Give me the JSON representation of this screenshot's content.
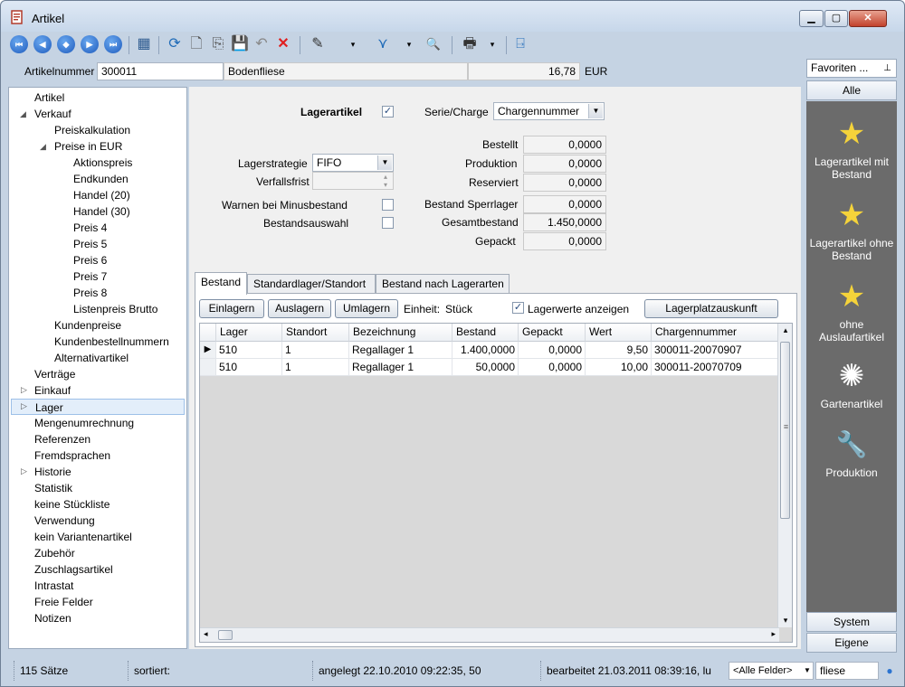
{
  "window": {
    "title": "Artikel",
    "min_glyph": "▁",
    "max_glyph": "▢",
    "close_glyph": "✕"
  },
  "toolbar": {
    "nav_first": "⏮",
    "nav_prev": "◀",
    "nav_both": "◆",
    "nav_next": "▶",
    "nav_last": "⏭",
    "glyphs": {
      "table": "▦",
      "refresh": "⟳",
      "new": "🗋",
      "copy": "⎘",
      "save": "💾",
      "undo": "↶",
      "delete": "✕",
      "tools": "✎",
      "filter": "⋎",
      "search": "🔍",
      "print": "🖶",
      "exit": "⍈",
      "dropdown": "▾"
    }
  },
  "header": {
    "artikelnummer_label": "Artikelnummer",
    "artikelnummer": "300011",
    "bezeichnung": "Bodenfliese",
    "preis": "16,78",
    "waehrung": "EUR"
  },
  "tree": {
    "expanded_glyph": "◢",
    "collapsed_glyph": "▷",
    "items": [
      {
        "label": "Artikel"
      },
      {
        "label": "Verkauf"
      },
      {
        "label": "Preiskalkulation"
      },
      {
        "label": "Preise in EUR"
      },
      {
        "label": "Aktionspreis"
      },
      {
        "label": "Endkunden"
      },
      {
        "label": "Handel (20)"
      },
      {
        "label": "Handel (30)"
      },
      {
        "label": "Preis 4"
      },
      {
        "label": "Preis 5"
      },
      {
        "label": "Preis 6"
      },
      {
        "label": "Preis 7"
      },
      {
        "label": "Preis 8"
      },
      {
        "label": "Listenpreis Brutto"
      },
      {
        "label": "Kundenpreise"
      },
      {
        "label": "Kundenbestellnummern"
      },
      {
        "label": "Alternativartikel"
      },
      {
        "label": "Verträge"
      },
      {
        "label": "Einkauf"
      },
      {
        "label": "Lager"
      },
      {
        "label": "Mengenumrechnung"
      },
      {
        "label": "Referenzen"
      },
      {
        "label": "Fremdsprachen"
      },
      {
        "label": "Historie"
      },
      {
        "label": "Statistik"
      },
      {
        "label": "keine Stückliste"
      },
      {
        "label": "Verwendung"
      },
      {
        "label": "kein Variantenartikel"
      },
      {
        "label": "Zubehör"
      },
      {
        "label": "Zuschlagsartikel"
      },
      {
        "label": "Intrastat"
      },
      {
        "label": "Freie Felder"
      },
      {
        "label": "Notizen"
      }
    ]
  },
  "form": {
    "lagerartikel_label": "Lagerartikel",
    "lagerartikel_checked": "✓",
    "serie_label": "Serie/Charge",
    "serie_value": "Chargennummer",
    "lagerstrategie_label": "Lagerstrategie",
    "lagerstrategie_value": "FIFO",
    "verfallsfrist_label": "Verfallsfrist",
    "verfallsfrist_value": "",
    "warnen_label": "Warnen bei Minusbestand",
    "bestandsauswahl_label": "Bestandsauswahl",
    "combo_arrow": "▼",
    "spin_up": "▴",
    "spin_down": "▾",
    "stats": [
      {
        "label": "Bestellt",
        "value": "0,0000"
      },
      {
        "label": "Produktion",
        "value": "0,0000"
      },
      {
        "label": "Reserviert",
        "value": "0,0000"
      },
      {
        "label": "Bestand Sperrlager",
        "value": "0,0000"
      },
      {
        "label": "Gesamtbestand",
        "value": "1.450,0000"
      },
      {
        "label": "Gepackt",
        "value": "0,0000"
      }
    ]
  },
  "tabs": [
    {
      "label": "Bestand"
    },
    {
      "label": "Standardlager/Standort"
    },
    {
      "label": "Bestand nach Lagerarten"
    }
  ],
  "panel": {
    "einlagern": "Einlagern",
    "auslagern": "Auslagern",
    "umlagern": "Umlagern",
    "einheit_label": "Einheit:",
    "einheit_value": "Stück",
    "lagerwerte_label": "Lagerwerte anzeigen",
    "lagerwerte_checked": "✓",
    "lagerplatz": "Lagerplatzauskunft"
  },
  "grid": {
    "columns": [
      "Lager",
      "Standort",
      "Bezeichnung",
      "Bestand",
      "Gepackt",
      "Wert",
      "Chargennummer"
    ],
    "current_row_glyph": "▶",
    "rows": [
      [
        "510",
        "1",
        "Regallager 1",
        "1.400,0000",
        "0,0000",
        "9,50",
        "300011-20070907"
      ],
      [
        "510",
        "1",
        "Regallager 1",
        "50,0000",
        "0,0000",
        "10,00",
        "300011-20070709"
      ]
    ],
    "scroll_up": "▴",
    "scroll_down": "▾",
    "scroll_left": "◂",
    "scroll_right": "▸",
    "grip": "≡"
  },
  "favorites": {
    "header": "Favoriten ...",
    "pin": "⊥",
    "tab_all": "Alle",
    "items": [
      {
        "label": "Lagerartikel mit Bestand",
        "icon": "★",
        "color": "#f5d33a"
      },
      {
        "label": "Lagerartikel ohne Bestand",
        "icon": "★",
        "color": "#f5d33a"
      },
      {
        "label": "ohne Auslaufartikel",
        "icon": "★",
        "color": "#f5d33a"
      },
      {
        "label": "Gartenartikel",
        "icon": "✺",
        "color": "#ffffff"
      },
      {
        "label": "Produktion",
        "icon": "🔧",
        "color": "#f0c040"
      }
    ],
    "tab_system": "System",
    "tab_eigene": "Eigene"
  },
  "status": {
    "saetze": "115 Sätze",
    "sortiert": "sortiert:",
    "angelegt": "angelegt 22.10.2010 09:22:35, 50",
    "bearbeitet": "bearbeitet 21.03.2011 08:39:16, lu",
    "alle_felder": "<Alle Felder>",
    "dropdown": "▼",
    "search_value": "fliese",
    "go_glyph": "●"
  }
}
